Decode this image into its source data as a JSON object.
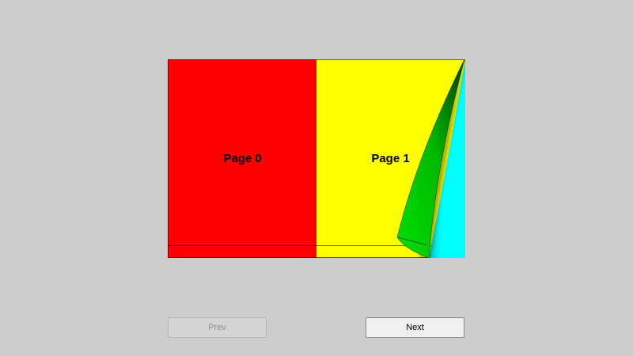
{
  "book": {
    "pages": [
      {
        "label": "Page 0",
        "color": "#ff0000"
      },
      {
        "label": "Page 1",
        "color": "#ffff00"
      }
    ],
    "curl": {
      "front_color": "#00cc00",
      "back_color": "#00ffff"
    }
  },
  "nav": {
    "prev_label": "Prev",
    "next_label": "Next",
    "prev_disabled": true
  }
}
